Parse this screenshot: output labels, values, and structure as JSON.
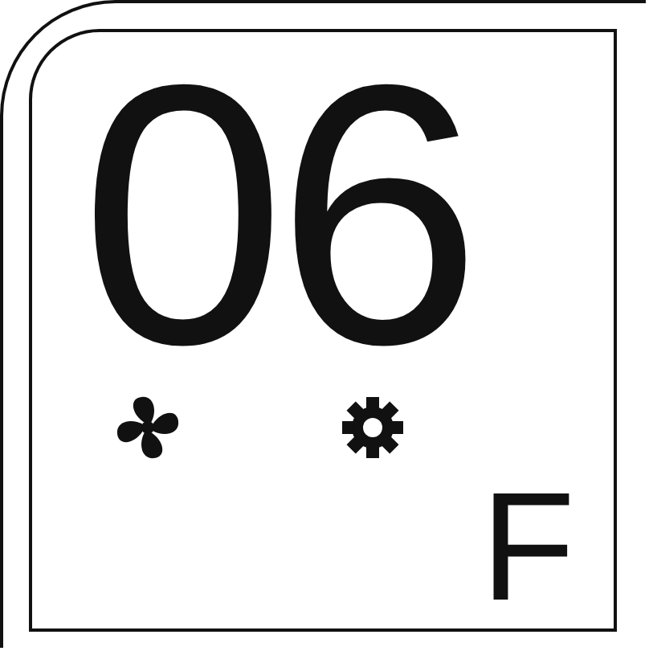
{
  "display": {
    "digits": "06",
    "unit": "F",
    "indicators": [
      {
        "kind": "fan",
        "on": true
      },
      {
        "kind": "gear",
        "on": true
      }
    ]
  }
}
